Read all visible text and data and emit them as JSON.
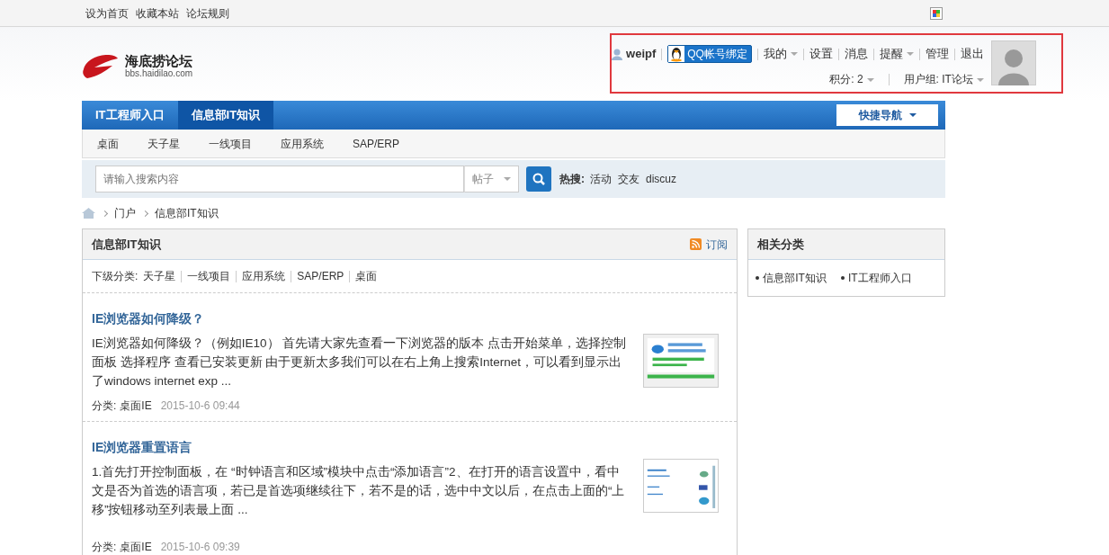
{
  "top_links": [
    "设为首页",
    "收藏本站",
    "论坛规则"
  ],
  "logo": {
    "name": "海底捞论坛",
    "url": "bbs.haidilao.com"
  },
  "user_panel": {
    "highlighted": true,
    "username": "weipf",
    "qq_bind": "QQ帐号绑定",
    "menu": [
      {
        "label": "我的",
        "dropdown": true
      },
      {
        "label": "设置",
        "dropdown": false
      },
      {
        "label": "消息",
        "dropdown": false
      },
      {
        "label": "提醒",
        "dropdown": true
      },
      {
        "label": "管理",
        "dropdown": false
      },
      {
        "label": "退出",
        "dropdown": false
      }
    ],
    "stats": [
      {
        "label": "积分: 2",
        "dropdown": true
      },
      {
        "label": "用户组: IT论坛",
        "dropdown": true
      }
    ]
  },
  "main_nav": {
    "tabs": [
      {
        "label": "IT工程师入口",
        "selected": false
      },
      {
        "label": "信息部IT知识",
        "selected": true
      }
    ],
    "quick_nav": "快捷导航"
  },
  "sub_nav": [
    "桌面",
    "天子星",
    "一线项目",
    "应用系统",
    "SAP/ERP"
  ],
  "search": {
    "placeholder": "请输入搜索内容",
    "type": "帖子",
    "hot_label": "热搜:",
    "hot": [
      "活动",
      "交友",
      "discuz"
    ]
  },
  "breadcrumb": [
    "门户",
    "信息部IT知识"
  ],
  "article_list": {
    "title": "信息部IT知识",
    "subscribe": "订阅",
    "subcat_label": "下级分类:",
    "subcats": [
      "天子星",
      "一线项目",
      "应用系统",
      "SAP/ERP",
      "桌面"
    ],
    "articles": [
      {
        "title": "IE浏览器如何降级？",
        "summary": "IE浏览器如何降级？（例如IE10） 首先请大家先查看一下浏览器的版本 点击开始菜单，选择控制面板 选择程序 查看已安装更新 由于更新太多我们可以在右上角上搜索Internet，可以看到显示出了windows internet exp ...",
        "category_label": "分类:",
        "category": "桌面IE",
        "date": "2015-10-6 09:44"
      },
      {
        "title": "IE浏览器重置语言",
        "summary": "1.首先打开控制面板，在 “时钟语言和区域”模块中点击“添加语言”2、在打开的语言设置中，看中文是否为首选的语言项，若已是首选项继续往下，若不是的话，选中中文以后，在点击上面的“上移”按钮移动至列表最上面 ...",
        "category_label": "分类:",
        "category": "桌面IE",
        "date": "2015-10-6 09:39"
      }
    ]
  },
  "related": {
    "title": "相关分类",
    "items": [
      "信息部IT知识",
      "IT工程师入口"
    ]
  }
}
